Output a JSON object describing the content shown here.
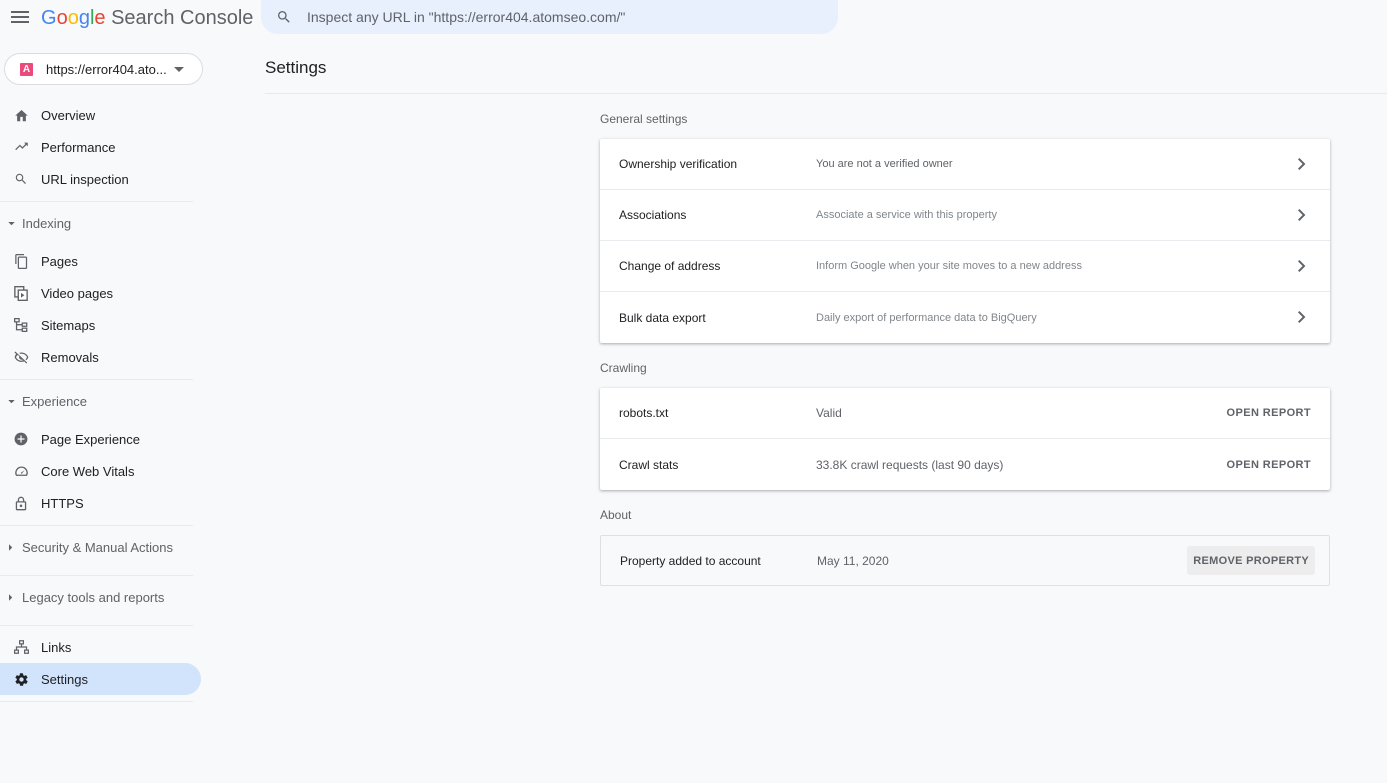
{
  "app": {
    "logo_google": "Google",
    "logo_product": "Search Console"
  },
  "search": {
    "placeholder": "Inspect any URL in \"https://error404.atomseo.com/\""
  },
  "property": {
    "icon_letter": "A",
    "label": "https://error404.ato..."
  },
  "nav": {
    "overview": "Overview",
    "performance": "Performance",
    "url_inspection": "URL inspection",
    "indexing": "Indexing",
    "pages": "Pages",
    "video_pages": "Video pages",
    "sitemaps": "Sitemaps",
    "removals": "Removals",
    "experience": "Experience",
    "page_experience": "Page Experience",
    "core_web_vitals": "Core Web Vitals",
    "https": "HTTPS",
    "security": "Security & Manual Actions",
    "legacy": "Legacy tools and reports",
    "links": "Links",
    "settings": "Settings"
  },
  "main": {
    "title": "Settings",
    "general": {
      "heading": "General settings",
      "rows": [
        {
          "label": "Ownership verification",
          "desc": "You are not a verified owner"
        },
        {
          "label": "Associations",
          "desc": "Associate a service with this property"
        },
        {
          "label": "Change of address",
          "desc": "Inform Google when your site moves to a new address"
        },
        {
          "label": "Bulk data export",
          "desc": "Daily export of performance data to BigQuery"
        }
      ]
    },
    "crawling": {
      "heading": "Crawling",
      "rows": [
        {
          "label": "robots.txt",
          "desc": "Valid",
          "action": "OPEN REPORT"
        },
        {
          "label": "Crawl stats",
          "desc": "33.8K crawl requests (last 90 days)",
          "action": "OPEN REPORT"
        }
      ]
    },
    "about": {
      "heading": "About",
      "label": "Property added to account",
      "date": "May 11, 2020",
      "action": "REMOVE PROPERTY"
    }
  },
  "colors": {
    "accent": "#1a73e8",
    "active_nav": "#d2e3fc",
    "search_bg": "#e8f0fe",
    "property_icon": "#ea4b7b"
  }
}
